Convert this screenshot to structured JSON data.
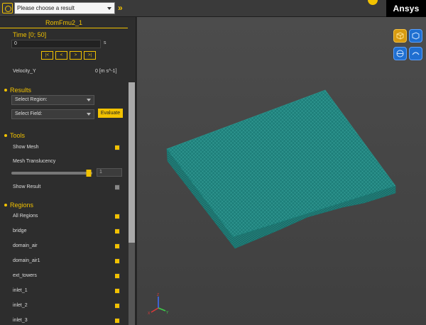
{
  "topbar": {
    "result_placeholder": "Please choose a result",
    "forward_icon": "double-chevron-right-icon",
    "brand": "Ansys"
  },
  "panel": {
    "title": "RomFmu2_1",
    "time_label": "Time [0; 50]",
    "time_value": "0",
    "time_unit": "s",
    "time_buttons": [
      "|<",
      "<",
      ">",
      ">|"
    ],
    "velocity_name": "Velocity_Y",
    "velocity_unit": "0 [m s^-1]"
  },
  "results": {
    "header": "Results",
    "region_dropdown": "Select Region:",
    "field_dropdown": "Select Field:",
    "evaluate_label": "Evaluate"
  },
  "tools": {
    "header": "Tools",
    "show_mesh_label": "Show Mesh",
    "show_mesh": true,
    "mesh_translucency_label": "Mesh Translucency",
    "mesh_translucency_level": 0.96,
    "mesh_translucency_value": "1",
    "show_result_label": "Show Result",
    "show_result": false
  },
  "regions": {
    "header": "Regions",
    "items": [
      {
        "label": "All Regions",
        "checked": true
      },
      {
        "label": "bridge",
        "checked": true
      },
      {
        "label": "domain_air",
        "checked": true
      },
      {
        "label": "domain_air1",
        "checked": true
      },
      {
        "label": "ext_towers",
        "checked": true
      },
      {
        "label": "inlet_1",
        "checked": true
      },
      {
        "label": "inlet_2",
        "checked": true
      },
      {
        "label": "inlet_3",
        "checked": true
      }
    ]
  },
  "viewport": {
    "mesh_color": "#1e7f7a",
    "view_icons": [
      "cube-view-icon",
      "iso-view-icon",
      "rotate-view-icon",
      "fit-view-icon"
    ]
  },
  "colors": {
    "accent": "#f2c200",
    "panel_bg": "#2d2d2d",
    "viewport_bg": "#464646"
  }
}
